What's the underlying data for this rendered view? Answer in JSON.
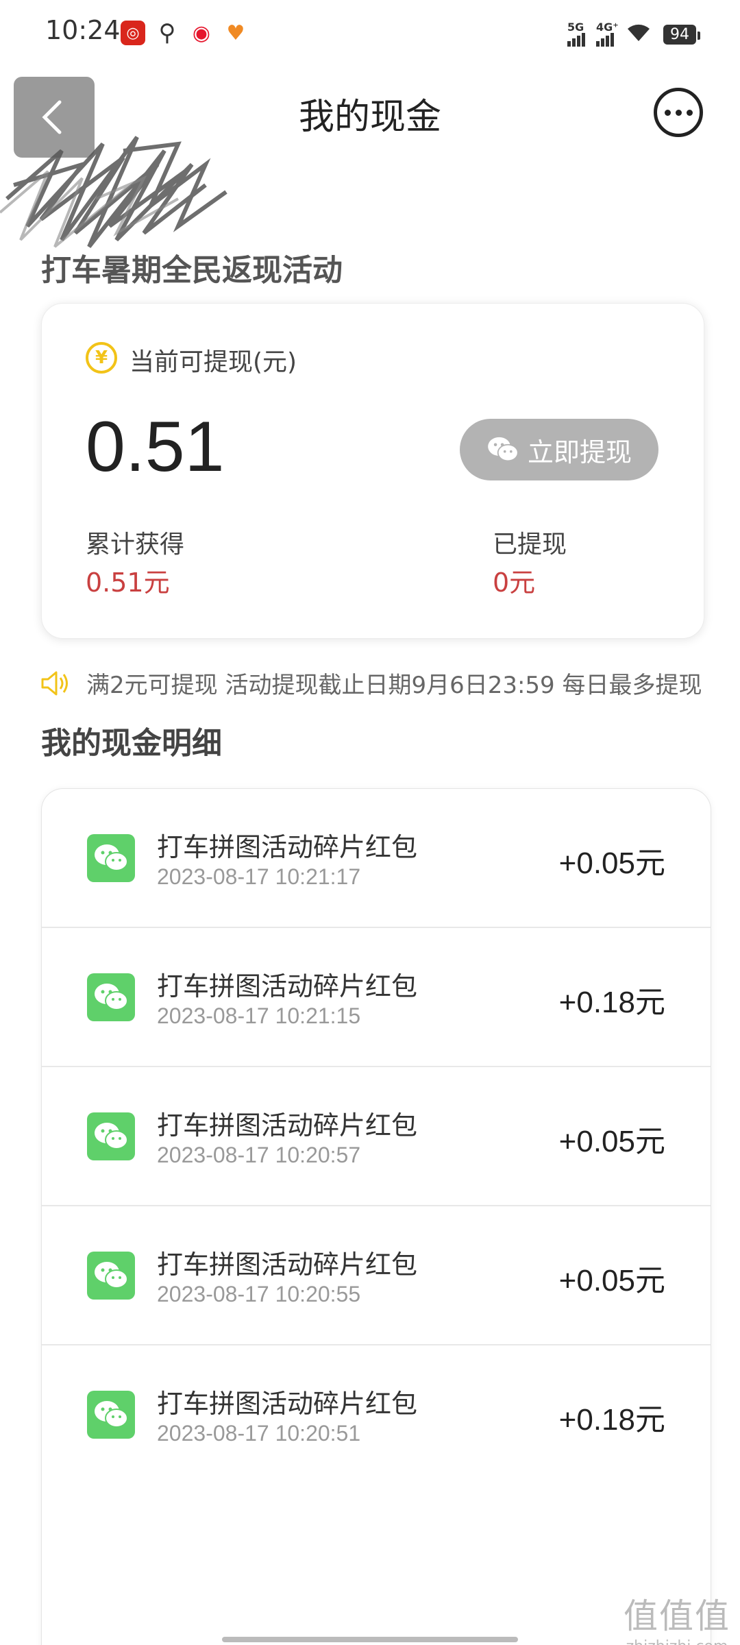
{
  "status_bar": {
    "time": "10:24",
    "network_5g": "5G",
    "network_4g": "4G⁺",
    "battery": "94"
  },
  "nav": {
    "title": "我的现金"
  },
  "activity_title": "打车暑期全民返现活动",
  "balance": {
    "label": "当前可提现(元)",
    "amount": "0.51",
    "withdraw_button": "立即提现",
    "total_earned_label": "累计获得",
    "total_earned_value": "0.51元",
    "withdrawn_label": "已提现",
    "withdrawn_value": "0元"
  },
  "notice": "满2元可提现 活动提现截止日期9月6日23:59 每日最多提现",
  "details": {
    "title": "我的现金明细",
    "items": [
      {
        "title": "打车拼图活动碎片红包",
        "time": "2023-08-17 10:21:17",
        "amount": "+0.05元"
      },
      {
        "title": "打车拼图活动碎片红包",
        "time": "2023-08-17 10:21:15",
        "amount": "+0.18元"
      },
      {
        "title": "打车拼图活动碎片红包",
        "time": "2023-08-17 10:20:57",
        "amount": "+0.05元"
      },
      {
        "title": "打车拼图活动碎片红包",
        "time": "2023-08-17 10:20:55",
        "amount": "+0.05元"
      },
      {
        "title": "打车拼图活动碎片红包",
        "time": "2023-08-17 10:20:51",
        "amount": "+0.18元"
      }
    ]
  },
  "watermark": {
    "logo": "值值值",
    "url": "zhizhizhi.com"
  },
  "colors": {
    "accent_red": "#c94040",
    "wechat_green": "#5fd06a",
    "coin_yellow": "#f2c318",
    "button_gray": "#b3b3b3"
  }
}
